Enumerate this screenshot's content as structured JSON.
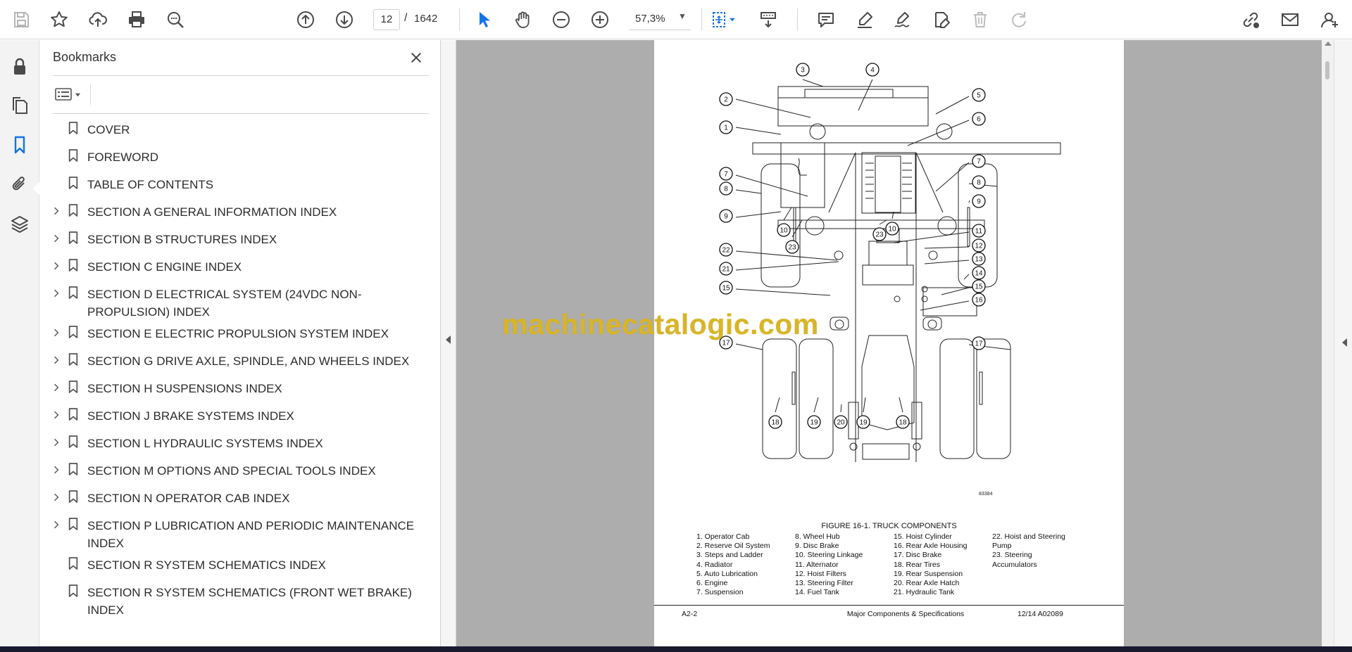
{
  "toolbar": {
    "page_current": "12",
    "page_separator": "/",
    "page_total": "1642",
    "zoom": "57,3%",
    "accent": "#1473e6"
  },
  "bookmarks": {
    "title": "Bookmarks",
    "items": [
      {
        "label": "COVER",
        "expandable": false
      },
      {
        "label": "FOREWORD",
        "expandable": false
      },
      {
        "label": "TABLE OF CONTENTS",
        "expandable": false
      },
      {
        "label": "SECTION A GENERAL INFORMATION INDEX",
        "expandable": true
      },
      {
        "label": "SECTION B STRUCTURES INDEX",
        "expandable": true
      },
      {
        "label": "SECTION C ENGINE INDEX",
        "expandable": true
      },
      {
        "label": "SECTION D ELECTRICAL SYSTEM (24VDC NON-PROPULSION) INDEX",
        "expandable": true
      },
      {
        "label": "SECTION E ELECTRIC PROPULSION SYSTEM INDEX",
        "expandable": true
      },
      {
        "label": "SECTION G DRIVE AXLE, SPINDLE, AND WHEELS INDEX",
        "expandable": true
      },
      {
        "label": "SECTION H SUSPENSIONS INDEX",
        "expandable": true
      },
      {
        "label": "SECTION J BRAKE SYSTEMS INDEX",
        "expandable": true
      },
      {
        "label": "SECTION L HYDRAULIC SYSTEMS INDEX",
        "expandable": true
      },
      {
        "label": "SECTION M OPTIONS AND SPECIAL TOOLS INDEX",
        "expandable": true
      },
      {
        "label": "SECTION N OPERATOR CAB INDEX",
        "expandable": true
      },
      {
        "label": "SECTION P LUBRICATION AND PERIODIC MAINTENANCE INDEX",
        "expandable": true
      },
      {
        "label": "SECTION R SYSTEM SCHEMATICS INDEX",
        "expandable": false
      },
      {
        "label": "SECTION R SYSTEM SCHEMATICS (FRONT WET BRAKE) INDEX",
        "expandable": false
      }
    ]
  },
  "document": {
    "figure_id": "83384",
    "figure_caption": "FIGURE 16-1. TRUCK COMPONENTS",
    "legend_col1": [
      "1. Operator Cab",
      "2. Reserve Oil System",
      "3. Steps and Ladder",
      "4. Radiator",
      "5. Auto Lubrication",
      "6. Engine",
      "7. Suspension"
    ],
    "legend_col2": [
      "8. Wheel Hub",
      "9. Disc Brake",
      "10. Steering Linkage",
      "11. Alternator",
      "12. Hoist Filters",
      "13. Steering Filter",
      "14. Fuel Tank"
    ],
    "legend_col3": [
      "15. Hoist Cylinder",
      "16. Rear Axle Housing",
      "17. Disc Brake",
      "18. Rear Tires",
      "19. Rear Suspension",
      "20. Rear Axle Hatch",
      "21. Hydraulic Tank"
    ],
    "legend_col4": [
      "22. Hoist and Steering",
      "Pump",
      "23. Steering",
      "Accumulators"
    ],
    "callouts": [
      "1",
      "2",
      "3",
      "4",
      "5",
      "6",
      "7",
      "7",
      "8",
      "8",
      "9",
      "9",
      "10",
      "10",
      "11",
      "12",
      "13",
      "14",
      "15",
      "15",
      "16",
      "17",
      "17",
      "18",
      "18",
      "19",
      "19",
      "20",
      "21",
      "22",
      "23",
      "23"
    ],
    "footer_left": "A2-2",
    "footer_center": "Major Components & Specifications",
    "footer_right": "12/14   A02089"
  },
  "watermark": "machinecatalogic.com"
}
